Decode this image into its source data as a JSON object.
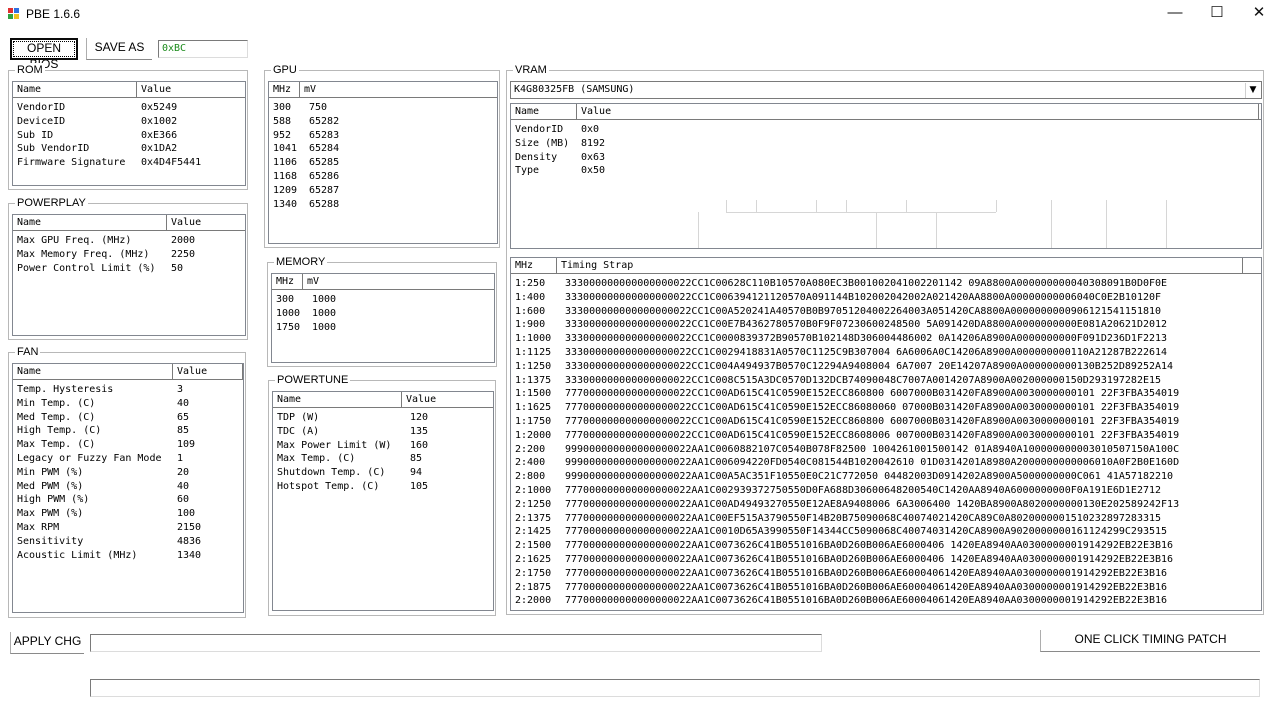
{
  "window": {
    "title": "PBE 1.6.6",
    "minimize": "—",
    "maximize": "☐",
    "close": "✕",
    "icon_colors": [
      "#e03030",
      "#3070e0",
      "#30a040",
      "#f0c020"
    ]
  },
  "toolbar": {
    "open_bios": "OPEN BIOS",
    "save_as": "SAVE AS",
    "checksum": "0xBC",
    "checksum_color": "#1a8a1a"
  },
  "rom": {
    "label": "ROM",
    "headers": [
      "Name",
      "Value"
    ],
    "rows": [
      [
        "VendorID",
        "0x5249"
      ],
      [
        "DeviceID",
        "0x1002"
      ],
      [
        "Sub ID",
        "0xE366"
      ],
      [
        "Sub VendorID",
        "0x1DA2"
      ],
      [
        "Firmware Signature",
        "0x4D4F5441"
      ]
    ]
  },
  "powerplay": {
    "label": "POWERPLAY",
    "headers": [
      "Name",
      "Value"
    ],
    "rows": [
      [
        "Max GPU Freq. (MHz)",
        "2000"
      ],
      [
        "Max Memory Freq. (MHz)",
        "2250"
      ],
      [
        "Power Control Limit (%)",
        "50"
      ]
    ]
  },
  "fan": {
    "label": "FAN",
    "headers": [
      "Name",
      "Value"
    ],
    "rows": [
      [
        "Temp. Hysteresis",
        "3"
      ],
      [
        "Min Temp. (C)",
        "40"
      ],
      [
        "Med Temp. (C)",
        "65"
      ],
      [
        "High Temp. (C)",
        "85"
      ],
      [
        "Max Temp. (C)",
        "109"
      ],
      [
        "Legacy or Fuzzy Fan Mode",
        "1"
      ],
      [
        "Min PWM (%)",
        "20"
      ],
      [
        "Med PWM (%)",
        "40"
      ],
      [
        "High PWM (%)",
        "60"
      ],
      [
        "Max PWM (%)",
        "100"
      ],
      [
        "Max RPM",
        "2150"
      ],
      [
        "Sensitivity",
        "4836"
      ],
      [
        "Acoustic Limit (MHz)",
        "1340"
      ]
    ]
  },
  "gpu": {
    "label": "GPU",
    "headers": [
      "MHz",
      "mV"
    ],
    "rows": [
      [
        "300",
        "750"
      ],
      [
        "588",
        "65282"
      ],
      [
        "952",
        "65283"
      ],
      [
        "1041",
        "65284"
      ],
      [
        "1106",
        "65285"
      ],
      [
        "1168",
        "65286"
      ],
      [
        "1209",
        "65287"
      ],
      [
        "1340",
        "65288"
      ]
    ]
  },
  "memory": {
    "label": "MEMORY",
    "headers": [
      "MHz",
      "mV"
    ],
    "rows": [
      [
        "300",
        "1000"
      ],
      [
        "1000",
        "1000"
      ],
      [
        "1750",
        "1000"
      ]
    ]
  },
  "powertune": {
    "label": "POWERTUNE",
    "headers": [
      "Name",
      "Value"
    ],
    "rows": [
      [
        "TDP (W)",
        "120"
      ],
      [
        "TDC (A)",
        "135"
      ],
      [
        "Max Power Limit (W)",
        "160"
      ],
      [
        "Max Temp. (C)",
        "85"
      ],
      [
        "Shutdown Temp. (C)",
        "94"
      ],
      [
        "Hotspot Temp. (C)",
        "105"
      ]
    ]
  },
  "vram": {
    "label": "VRAM",
    "selected": "K4G80325FB (SAMSUNG)",
    "headers": [
      "Name",
      "Value"
    ],
    "rows": [
      [
        "VendorID",
        "0x0"
      ],
      [
        "Size (MB)",
        "8192"
      ],
      [
        "Density",
        "0x63"
      ],
      [
        "Type",
        "0x50"
      ]
    ]
  },
  "timing": {
    "headers": [
      "MHz",
      "Timing Strap"
    ],
    "rows": [
      [
        "1:250",
        "333000000000000000022CC1C00628C110B10570A080EC3B001002041002201142 09A8800A000000000040308091B0D0F0E"
      ],
      [
        "1:400",
        "333000000000000000022CC1C006394121120570A091144B102002042002A021420AA8800A00000000006040C0E2B10120F"
      ],
      [
        "1:600",
        "333000000000000000022CC1C00A520241A40570B0B97051204002264003A051420CA8800A0000000000906121541151810"
      ],
      [
        "1:900",
        "333000000000000000022CC1C00E7B4362780570B0F9F07230600248500 5A091420DA8800A0000000000E081A20621D2012"
      ],
      [
        "1:1000",
        "333000000000000000022CC1C0000839372B90570B102148D306004486002 0A14206A8900A0000000000F091D236D1F2213"
      ],
      [
        "1:1125",
        "333000000000000000022CC1C0029418831A0570C1125C9B307004 6A6006A0C14206A8900A000000000110A21287B222614"
      ],
      [
        "1:1250",
        "333000000000000000022CC1C004A494937B0570C12294A9408004 6A7007 20E14207A8900A000000000130B252D89252A14"
      ],
      [
        "1:1375",
        "333000000000000000022CC1C008C515A3DC0570D132DCB74090048C7007A0014207A8900A002000000150D293197282E15"
      ],
      [
        "1:1500",
        "777000000000000000022CC1C00AD615C41C0590E152ECC860800 6007000B031420FA8900A0030000000101 22F3FBA354019"
      ],
      [
        "1:1625",
        "777000000000000000022CC1C00AD615C41C0590E152ECC86080060 07000B031420FA8900A0030000000101 22F3FBA354019"
      ],
      [
        "1:1750",
        "777000000000000000022CC1C00AD615C41C0590E152ECC860800 6007000B031420FA8900A0030000000101 22F3FBA354019"
      ],
      [
        "1:2000",
        "777000000000000000022CC1C00AD615C41C0590E152ECC8608006 007000B031420FA8900A0030000000101 22F3FBA354019"
      ],
      [
        "2:200",
        "999000000000000000022AA1C0060882107C0540B078F82500 1004261001500142 01A8940A100000000003010507150A100C"
      ],
      [
        "2:400",
        "999000000000000000022AA1C006094220FD0540C081544B1020042610 01D0314201A8980A2000000000006010A0F2B0E160D"
      ],
      [
        "2:800",
        "999000000000000000022AA1C00A5AC351F10550E0C21C772050 04482003D0914202A8900A5000000000C061 41A57182210"
      ],
      [
        "2:1000",
        "777000000000000000022AA1C002939372750550D0FA688D30600648200540C1420AA8940A6000000000F0A191E6D1E2712"
      ],
      [
        "2:1250",
        "777000000000000000022AA1C00AD49493270550E12AE8A9408006 6A3006400 1420BA8900A8020000000130E202589242F13"
      ],
      [
        "2:1375",
        "777000000000000000022AA1C00EF515A3790550F14B20B75090068C40074021420CA89C0A8020000001510232897283315"
      ],
      [
        "2:1425",
        "777000000000000000022AA1C0010D65A3990550F14344CC5090068C40074031420CA8900A9020000000161124299C293515"
      ],
      [
        "2:1500",
        "777000000000000000022AA1C0073626C41B0551016BA0D260B006AE6000406 1420EA8940AA0300000001914292EB22E3B16"
      ],
      [
        "2:1625",
        "777000000000000000022AA1C0073626C41B0551016BA0D260B006AE6000406 1420EA8940AA0300000001914292EB22E3B16"
      ],
      [
        "2:1750",
        "777000000000000000022AA1C0073626C41B0551016BA0D260B006AE60004061420EA8940AA0300000001914292EB22E3B16"
      ],
      [
        "2:1875",
        "777000000000000000022AA1C0073626C41B0551016BA0D260B006AE60004061420EA8940AA0300000001914292EB22E3B16"
      ],
      [
        "2:2000",
        "777000000000000000022AA1C0073626C41B0551016BA0D260B006AE60004061420EA8940AA0300000001914292EB22E3B16"
      ]
    ]
  },
  "bottom": {
    "apply": "APPLY CHG",
    "apply_value": "",
    "timing_patch": "ONE CLICK TIMING PATCH",
    "status_value": ""
  }
}
